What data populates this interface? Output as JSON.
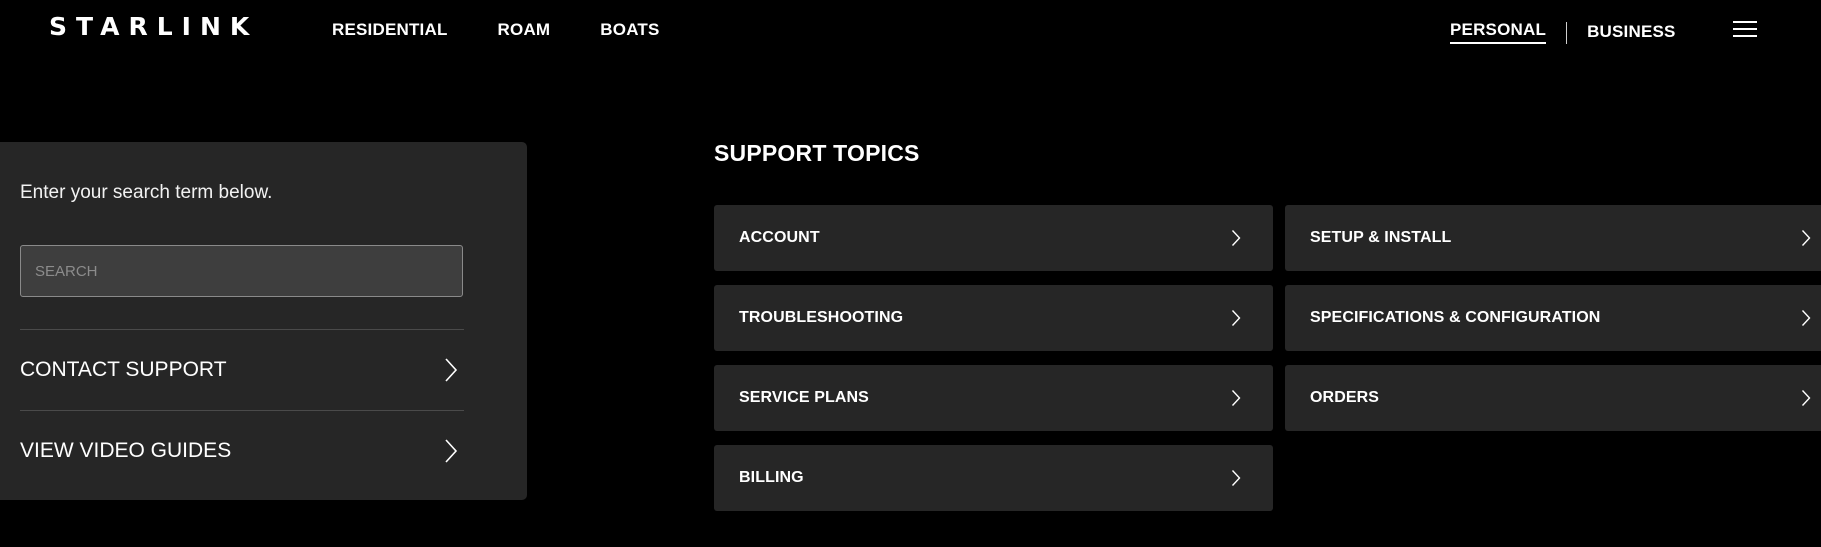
{
  "header": {
    "logo": "STARLINK",
    "nav": [
      "RESIDENTIAL",
      "ROAM",
      "BOATS"
    ],
    "segments": {
      "personal": "PERSONAL",
      "business": "BUSINESS",
      "active": "PERSONAL"
    },
    "menu_icon": "hamburger-menu-icon"
  },
  "search_panel": {
    "intro": "Enter your search term below.",
    "search_placeholder": "SEARCH",
    "search_value": "",
    "links": [
      {
        "label": "CONTACT SUPPORT",
        "icon": "chevron-right-icon"
      },
      {
        "label": "VIEW VIDEO GUIDES",
        "icon": "chevron-right-icon"
      }
    ]
  },
  "topics": {
    "title": "SUPPORT TOPICS",
    "items": [
      {
        "label": "ACCOUNT",
        "icon": "chevron-right-icon"
      },
      {
        "label": "SETUP & INSTALL",
        "icon": "chevron-right-icon"
      },
      {
        "label": "TROUBLESHOOTING",
        "icon": "chevron-right-icon"
      },
      {
        "label": "SPECIFICATIONS & CONFIGURATION",
        "icon": "chevron-right-icon"
      },
      {
        "label": "SERVICE PLANS",
        "icon": "chevron-right-icon"
      },
      {
        "label": "ORDERS",
        "icon": "chevron-right-icon"
      },
      {
        "label": "BILLING",
        "icon": "chevron-right-icon"
      }
    ]
  },
  "colors": {
    "background": "#000000",
    "panel": "#262626",
    "input_bg": "#3e3e3e",
    "text": "#ffffff"
  }
}
